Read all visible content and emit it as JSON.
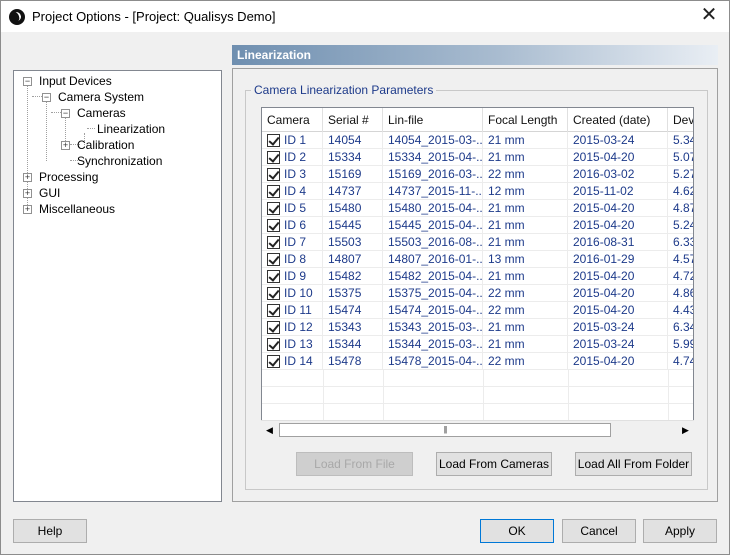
{
  "window": {
    "title": "Project Options - [Project: Qualisys Demo]"
  },
  "tree": {
    "items": [
      {
        "label": "Input Devices",
        "expander": "−"
      },
      {
        "label": "Camera System",
        "expander": "−"
      },
      {
        "label": "Cameras",
        "expander": "−"
      },
      {
        "label": "Linearization",
        "expander": ""
      },
      {
        "label": "Calibration",
        "expander": "+"
      },
      {
        "label": "Synchronization",
        "expander": ""
      },
      {
        "label": "Processing",
        "expander": "+"
      },
      {
        "label": "GUI",
        "expander": "+"
      },
      {
        "label": "Miscellaneous",
        "expander": "+"
      }
    ]
  },
  "panel": {
    "header": "Linearization",
    "group_title": "Camera Linearization Parameters"
  },
  "table": {
    "columns": [
      "Camera",
      "Serial #",
      "Lin-file",
      "Focal Length",
      "Created (date)",
      "Dev"
    ],
    "rows": [
      {
        "checked": true,
        "camera": "ID 1",
        "serial": "14054",
        "linfile": "14054_2015-03-...",
        "focal": "21 mm",
        "created": "2015-03-24",
        "dev": "5.34"
      },
      {
        "checked": true,
        "camera": "ID 2",
        "serial": "15334",
        "linfile": "15334_2015-04-...",
        "focal": "21 mm",
        "created": "2015-04-20",
        "dev": "5.07"
      },
      {
        "checked": true,
        "camera": "ID 3",
        "serial": "15169",
        "linfile": "15169_2016-03-...",
        "focal": "22 mm",
        "created": "2016-03-02",
        "dev": "5.27"
      },
      {
        "checked": true,
        "camera": "ID 4",
        "serial": "14737",
        "linfile": "14737_2015-11-...",
        "focal": "12 mm",
        "created": "2015-11-02",
        "dev": "4.62"
      },
      {
        "checked": true,
        "camera": "ID 5",
        "serial": "15480",
        "linfile": "15480_2015-04-...",
        "focal": "21 mm",
        "created": "2015-04-20",
        "dev": "4.87"
      },
      {
        "checked": true,
        "camera": "ID 6",
        "serial": "15445",
        "linfile": "15445_2015-04-...",
        "focal": "21 mm",
        "created": "2015-04-20",
        "dev": "5.24"
      },
      {
        "checked": true,
        "camera": "ID 7",
        "serial": "15503",
        "linfile": "15503_2016-08-...",
        "focal": "21 mm",
        "created": "2016-08-31",
        "dev": "6.33"
      },
      {
        "checked": true,
        "camera": "ID 8",
        "serial": "14807",
        "linfile": "14807_2016-01-...",
        "focal": "13 mm",
        "created": "2016-01-29",
        "dev": "4.57"
      },
      {
        "checked": true,
        "camera": "ID 9",
        "serial": "15482",
        "linfile": "15482_2015-04-...",
        "focal": "21 mm",
        "created": "2015-04-20",
        "dev": "4.72"
      },
      {
        "checked": true,
        "camera": "ID 10",
        "serial": "15375",
        "linfile": "15375_2015-04-...",
        "focal": "22 mm",
        "created": "2015-04-20",
        "dev": "4.86"
      },
      {
        "checked": true,
        "camera": "ID 11",
        "serial": "15474",
        "linfile": "15474_2015-04-...",
        "focal": "22 mm",
        "created": "2015-04-20",
        "dev": "4.43"
      },
      {
        "checked": true,
        "camera": "ID 12",
        "serial": "15343",
        "linfile": "15343_2015-03-...",
        "focal": "21 mm",
        "created": "2015-03-24",
        "dev": "6.34"
      },
      {
        "checked": true,
        "camera": "ID 13",
        "serial": "15344",
        "linfile": "15344_2015-03-...",
        "focal": "21 mm",
        "created": "2015-03-24",
        "dev": "5.99"
      },
      {
        "checked": true,
        "camera": "ID 14",
        "serial": "15478",
        "linfile": "15478_2015-04-...",
        "focal": "22 mm",
        "created": "2015-04-20",
        "dev": "4.74"
      }
    ]
  },
  "scrollbar": {
    "left_arrow": "◀",
    "right_arrow": "▶",
    "grip": "|||"
  },
  "buttons": {
    "load_from_file": "Load From File",
    "load_from_cameras": "Load From Cameras",
    "load_all_from_folder": "Load All From Folder",
    "help": "Help",
    "ok": "OK",
    "cancel": "Cancel",
    "apply": "Apply"
  }
}
